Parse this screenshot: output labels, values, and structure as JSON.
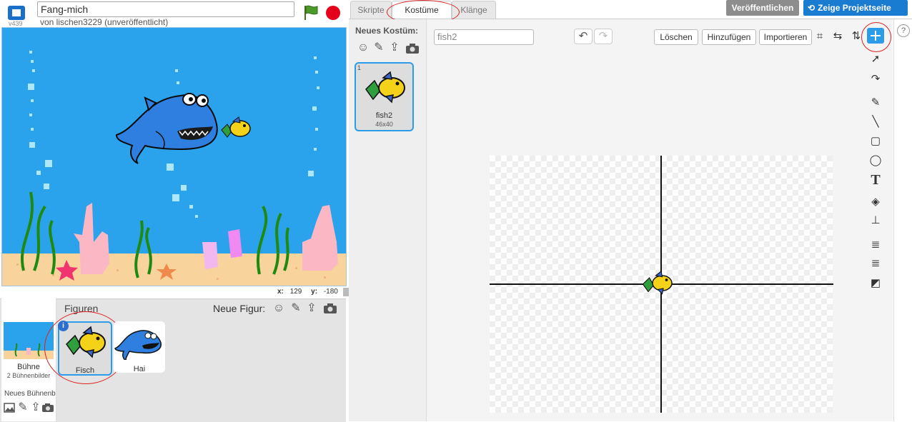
{
  "project": {
    "version": "v439",
    "title": "Fang-mich",
    "byline": "von lischen3229 (unveröffentlicht)"
  },
  "stage": {
    "x_label": "x:",
    "x_value": "129",
    "y_label": "y:",
    "y_value": "-180"
  },
  "sprites_pane": {
    "title": "Figuren",
    "new_sprite_label": "Neue Figur:",
    "stage_name": "Bühne",
    "stage_count": "2 Bühnenbilder",
    "new_backdrop_label": "Neues Bühnenbild",
    "sprites": [
      {
        "name": "Fisch"
      },
      {
        "name": "Hai"
      }
    ]
  },
  "tabs": [
    "Skripte",
    "Kostüme",
    "Klänge"
  ],
  "header_buttons": {
    "publish": "Veröffentlichen",
    "project_page": "Zeige Projektseite"
  },
  "costumes": {
    "new_costume_label": "Neues Kostüm:",
    "items": [
      {
        "number": "1",
        "name": "fish2",
        "size": "46x40"
      }
    ]
  },
  "editor": {
    "costume_name": "fish2",
    "clear": "Löschen",
    "add": "Hinzufügen",
    "import": "Importieren"
  },
  "colors": {
    "accent": "#2c9be8",
    "stage_water": "#2aa3ec",
    "stop": "#e4001b",
    "highlight_ring": "#d22222"
  }
}
